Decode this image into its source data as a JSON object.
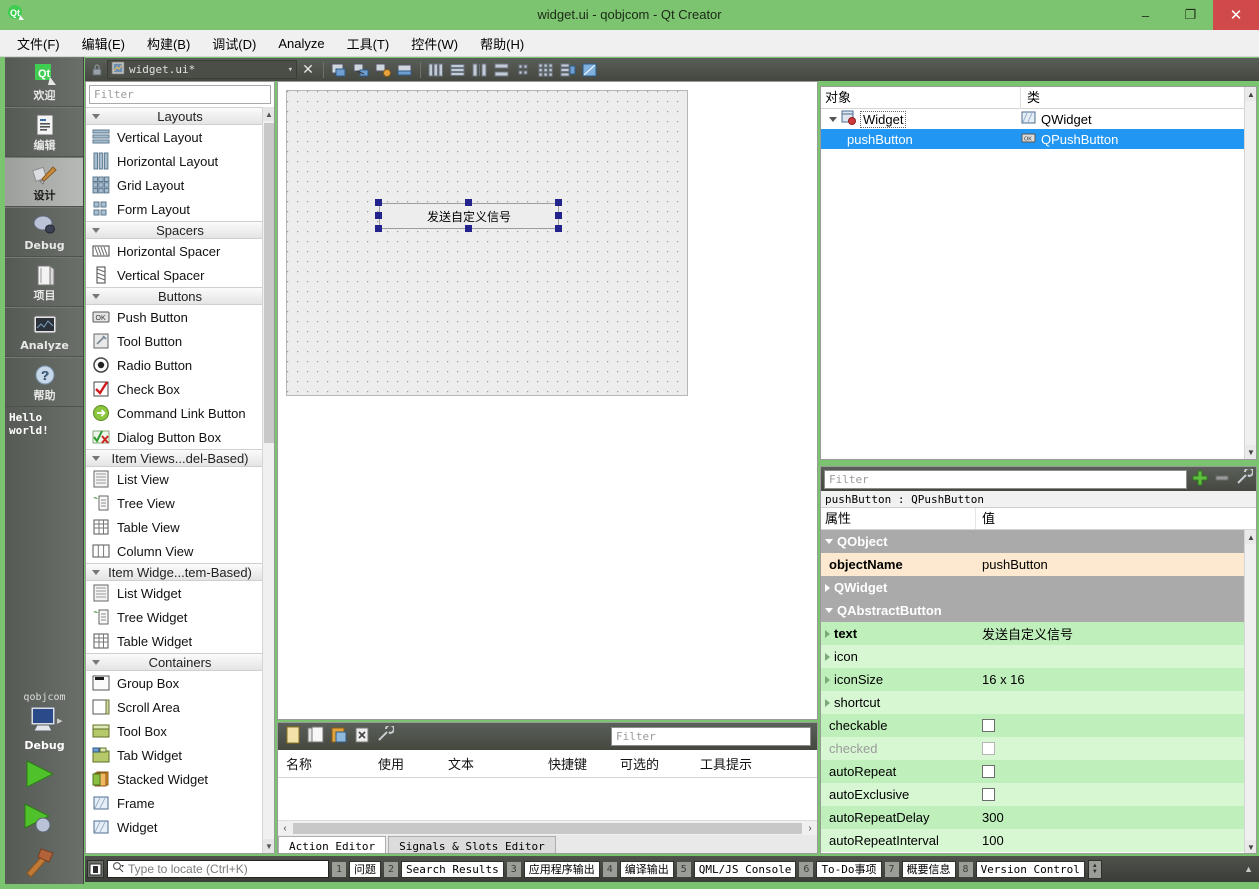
{
  "window": {
    "title": "widget.ui - qobjcom - Qt Creator",
    "app_icon": "qt-logo-icon",
    "minimize": "–",
    "maximize": "❐",
    "close": "✕",
    "accent_green": "#7cc470",
    "close_red": "#d04a4a"
  },
  "menubar": {
    "items": [
      {
        "label": "文件(F)",
        "name": "menu-file"
      },
      {
        "label": "编辑(E)",
        "name": "menu-edit"
      },
      {
        "label": "构建(B)",
        "name": "menu-build"
      },
      {
        "label": "调试(D)",
        "name": "menu-debug"
      },
      {
        "label": "Analyze",
        "name": "menu-analyze"
      },
      {
        "label": "工具(T)",
        "name": "menu-tools"
      },
      {
        "label": "控件(W)",
        "name": "menu-window"
      },
      {
        "label": "帮助(H)",
        "name": "menu-help"
      }
    ]
  },
  "modebar": {
    "modes": [
      {
        "label": "欢迎",
        "icon": "qt-welcome-icon",
        "active": false
      },
      {
        "label": "编辑",
        "icon": "edit-document-icon",
        "active": false
      },
      {
        "label": "设计",
        "icon": "design-brush-icon",
        "active": true
      },
      {
        "label": "Debug",
        "icon": "debug-bug-icon",
        "active": false
      },
      {
        "label": "项目",
        "icon": "projects-folder-icon",
        "active": false
      },
      {
        "label": "Analyze",
        "icon": "analyze-monitor-icon",
        "active": false
      },
      {
        "label": "帮助",
        "icon": "help-question-icon",
        "active": false
      }
    ],
    "project_note": "Hello world!",
    "kit": {
      "project_name": "qobjcom",
      "build_config": "Debug",
      "icon": "computer-kit-icon",
      "arrow": "▸"
    },
    "actions": [
      {
        "name": "run-button",
        "icon": "run-play-icon"
      },
      {
        "name": "debug-button",
        "icon": "debug-play-icon"
      },
      {
        "name": "build-button",
        "icon": "build-hammer-icon"
      }
    ]
  },
  "editor_toolbar": {
    "lock_icon": "lock-icon",
    "file_icon": "ui-file-icon",
    "file_name": "widget.ui*",
    "dropdown_caret": "▾",
    "close_label": "✕",
    "buttons": [
      {
        "name": "edit-widgets-button",
        "icon": "edit-widgets-icon"
      },
      {
        "name": "edit-signals-slots-button",
        "icon": "edit-signals-slots-icon"
      },
      {
        "name": "edit-buddies-button",
        "icon": "edit-buddies-icon"
      },
      {
        "name": "edit-tab-order-button",
        "icon": "edit-tab-order-icon"
      },
      {
        "name": "layout-horizontally-button",
        "icon": "layout-horizontal-icon"
      },
      {
        "name": "layout-vertically-button",
        "icon": "layout-vertical-icon"
      },
      {
        "name": "layout-splitter-horizontal-button",
        "icon": "layout-split-h-icon"
      },
      {
        "name": "layout-splitter-vertical-button",
        "icon": "layout-split-v-icon"
      },
      {
        "name": "layout-form-button",
        "icon": "layout-form-icon"
      },
      {
        "name": "layout-grid-button",
        "icon": "layout-grid-icon"
      },
      {
        "name": "break-layout-button",
        "icon": "break-layout-icon"
      },
      {
        "name": "adjust-size-button",
        "icon": "adjust-size-icon"
      }
    ]
  },
  "widgetbox": {
    "filter_placeholder": "Filter",
    "groups": [
      {
        "title": "Layouts",
        "expanded": true,
        "items": [
          {
            "label": "Vertical Layout",
            "icon": "vertical-layout-icon"
          },
          {
            "label": "Horizontal Layout",
            "icon": "horizontal-layout-icon"
          },
          {
            "label": "Grid Layout",
            "icon": "grid-layout-icon"
          },
          {
            "label": "Form Layout",
            "icon": "form-layout-icon"
          }
        ]
      },
      {
        "title": "Spacers",
        "expanded": true,
        "items": [
          {
            "label": "Horizontal Spacer",
            "icon": "horizontal-spacer-icon"
          },
          {
            "label": "Vertical Spacer",
            "icon": "vertical-spacer-icon"
          }
        ]
      },
      {
        "title": "Buttons",
        "expanded": true,
        "items": [
          {
            "label": "Push Button",
            "icon": "push-button-icon"
          },
          {
            "label": "Tool Button",
            "icon": "tool-button-icon"
          },
          {
            "label": "Radio Button",
            "icon": "radio-button-icon"
          },
          {
            "label": "Check Box",
            "icon": "check-box-icon"
          },
          {
            "label": "Command Link Button",
            "icon": "command-link-button-icon"
          },
          {
            "label": "Dialog Button Box",
            "icon": "dialog-button-box-icon"
          }
        ]
      },
      {
        "title": "Item Views...del-Based)",
        "expanded": true,
        "items": [
          {
            "label": "List View",
            "icon": "list-view-icon"
          },
          {
            "label": "Tree View",
            "icon": "tree-view-icon"
          },
          {
            "label": "Table View",
            "icon": "table-view-icon"
          },
          {
            "label": "Column View",
            "icon": "column-view-icon"
          }
        ]
      },
      {
        "title": "Item Widge...tem-Based)",
        "expanded": true,
        "items": [
          {
            "label": "List Widget",
            "icon": "list-widget-icon"
          },
          {
            "label": "Tree Widget",
            "icon": "tree-widget-icon"
          },
          {
            "label": "Table Widget",
            "icon": "table-widget-icon"
          }
        ]
      },
      {
        "title": "Containers",
        "expanded": true,
        "items": [
          {
            "label": "Group Box",
            "icon": "group-box-icon"
          },
          {
            "label": "Scroll Area",
            "icon": "scroll-area-icon"
          },
          {
            "label": "Tool Box",
            "icon": "tool-box-icon"
          },
          {
            "label": "Tab Widget",
            "icon": "tab-widget-icon"
          },
          {
            "label": "Stacked Widget",
            "icon": "stacked-widget-icon"
          },
          {
            "label": "Frame",
            "icon": "frame-icon"
          },
          {
            "label": "Widget",
            "icon": "widget-icon"
          }
        ]
      }
    ]
  },
  "form": {
    "button_text": "发送自定义信号",
    "selected": true
  },
  "action_editor": {
    "toolbar_buttons": [
      {
        "name": "new-action-button",
        "icon": "new-action-icon"
      },
      {
        "name": "copy-action-button",
        "icon": "copy-action-icon"
      },
      {
        "name": "paste-action-button",
        "icon": "paste-action-icon"
      },
      {
        "name": "delete-action-button",
        "icon": "delete-action-icon"
      },
      {
        "name": "edit-action-button",
        "icon": "wrench-icon"
      }
    ],
    "filter_placeholder": "Filter",
    "columns": [
      "名称",
      "使用",
      "文本",
      "快捷键",
      "可选的",
      "工具提示"
    ],
    "rows": [],
    "tabs": [
      {
        "label": "Action Editor",
        "active": true
      },
      {
        "label": "Signals & Slots Editor",
        "active": false
      }
    ],
    "scroll_left": "‹",
    "scroll_right": "›"
  },
  "object_inspector": {
    "columns": [
      "对象",
      "类"
    ],
    "rows": [
      {
        "name": "Widget",
        "class": "QWidget",
        "icon": "qwidget-form-icon",
        "class_icon": "qwidget-icon",
        "indent": 0,
        "expanded": true,
        "selected": false,
        "editing": true
      },
      {
        "name": "pushButton",
        "class": "QPushButton",
        "icon": "",
        "class_icon": "qpushbutton-icon",
        "indent": 1,
        "expanded": false,
        "selected": true,
        "editing": false
      }
    ]
  },
  "property_editor": {
    "filter_placeholder": "Filter",
    "add_icon": "plus-icon",
    "remove_icon": "minus-icon",
    "config_icon": "wrench-icon",
    "subject": "pushButton : QPushButton",
    "columns": [
      "属性",
      "值"
    ],
    "rows": [
      {
        "name": "QObject",
        "value": "",
        "kind": "group",
        "expanded": true
      },
      {
        "name": "objectName",
        "value": "pushButton",
        "kind": "highlight",
        "bold": true
      },
      {
        "name": "QWidget",
        "value": "",
        "kind": "group",
        "expanded": false
      },
      {
        "name": "QAbstractButton",
        "value": "",
        "kind": "group",
        "expanded": true
      },
      {
        "name": "text",
        "value": "发送自定义信号",
        "kind": "green",
        "bold": true,
        "arrow": "right"
      },
      {
        "name": "icon",
        "value": "",
        "kind": "green-alt",
        "arrow": "right"
      },
      {
        "name": "iconSize",
        "value": "16 x 16",
        "kind": "green",
        "arrow": "right"
      },
      {
        "name": "shortcut",
        "value": "",
        "kind": "green-alt",
        "arrow": "right"
      },
      {
        "name": "checkable",
        "value": "",
        "kind": "green",
        "checkbox": true,
        "checked": false
      },
      {
        "name": "checked",
        "value": "",
        "kind": "green-alt",
        "checkbox": true,
        "checked": false,
        "disabled": true
      },
      {
        "name": "autoRepeat",
        "value": "",
        "kind": "green",
        "checkbox": true,
        "checked": false
      },
      {
        "name": "autoExclusive",
        "value": "",
        "kind": "green-alt",
        "checkbox": true,
        "checked": false
      },
      {
        "name": "autoRepeatDelay",
        "value": "300",
        "kind": "green"
      },
      {
        "name": "autoRepeatInterval",
        "value": "100",
        "kind": "green-alt"
      }
    ]
  },
  "statusbar": {
    "mode_icon": "sidebar-toggle-icon",
    "locate_placeholder": "Type to locate (Ctrl+K)",
    "search_icon": "search-icon",
    "outputs": [
      {
        "num": "1",
        "label": "问题"
      },
      {
        "num": "2",
        "label": "Search Results"
      },
      {
        "num": "3",
        "label": "应用程序输出"
      },
      {
        "num": "4",
        "label": "编译输出"
      },
      {
        "num": "5",
        "label": "QML/JS Console"
      },
      {
        "num": "6",
        "label": "To-Do事项"
      },
      {
        "num": "7",
        "label": "概要信息"
      },
      {
        "num": "8",
        "label": "Version Control"
      }
    ],
    "spinner_icon": "up-down-icon",
    "collapse_icon": "▲"
  }
}
